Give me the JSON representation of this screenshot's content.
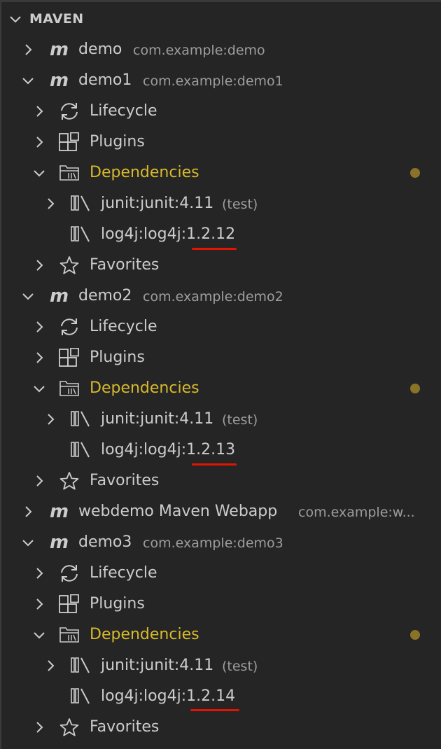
{
  "panel": {
    "title": "MAVEN"
  },
  "projects": [
    {
      "name": "demo",
      "desc": "com.example:demo",
      "expanded": false
    },
    {
      "name": "demo1",
      "desc": "com.example:demo1",
      "expanded": true,
      "children": [
        "Lifecycle",
        "Plugins",
        "Dependencies",
        "Favorites"
      ],
      "dependencies": [
        {
          "id": "junit:junit:4.11",
          "scope": "(test)"
        },
        {
          "id_prefix": "log4j:log4j:",
          "version": "1.2.12"
        }
      ]
    },
    {
      "name": "demo2",
      "desc": "com.example:demo2",
      "expanded": true,
      "children": [
        "Lifecycle",
        "Plugins",
        "Dependencies",
        "Favorites"
      ],
      "dependencies": [
        {
          "id": "junit:junit:4.11",
          "scope": "(test)"
        },
        {
          "id_prefix": "log4j:log4j:",
          "version": "1.2.13"
        }
      ]
    },
    {
      "name": "webdemo Maven Webapp",
      "desc": "com.example:w...",
      "expanded": false
    },
    {
      "name": "demo3",
      "desc": "com.example:demo3",
      "expanded": true,
      "children": [
        "Lifecycle",
        "Plugins",
        "Dependencies",
        "Favorites"
      ],
      "dependencies": [
        {
          "id": "junit:junit:4.11",
          "scope": "(test)"
        },
        {
          "id_prefix": "log4j:log4j:",
          "version": "1.2.14"
        }
      ]
    }
  ],
  "colors": {
    "background": "#252526",
    "text": "#cccccc",
    "description": "#9d9d9d",
    "modified_label": "#d7ba2a",
    "modified_dot": "#8a7328",
    "underline": "#e51400"
  },
  "icons": {
    "project": "maven-m-icon",
    "lifecycle": "sync-icon",
    "plugins": "extensions-icon",
    "dependencies": "library-folder-icon",
    "dependency": "library-icon",
    "favorites": "star-icon",
    "collapsed": "chevron-right-icon",
    "expanded": "chevron-down-icon"
  }
}
